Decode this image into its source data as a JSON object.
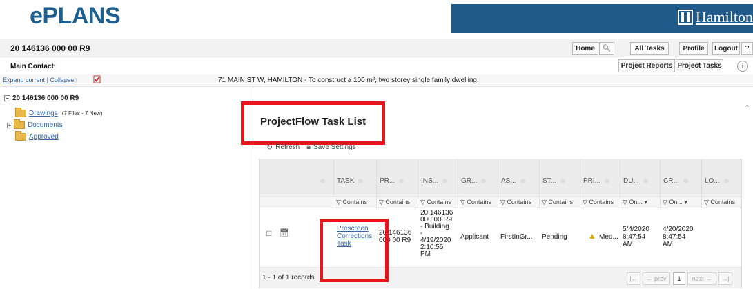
{
  "header": {
    "logo": "ePLANS",
    "city_logo": "Hamilton"
  },
  "titlebar": {
    "project_id": "20 146136 000 00 R9",
    "home": "Home",
    "all_tasks": "All Tasks",
    "profile": "Profile",
    "logout": "Logout",
    "help": "?",
    "project_reports": "Project Reports",
    "project_tasks": "Project Tasks",
    "info": "i"
  },
  "contact": {
    "label": "Main Contact:"
  },
  "expand": {
    "expand_current": "Expand current",
    "separator": "|",
    "collapse": "Collapse",
    "separator2": "|"
  },
  "address": "71 MAIN ST W, HAMILTON - To construct a 100 m², two storey single family dwelling.",
  "tree": {
    "root": "20 146136 000 00 R9",
    "items": [
      {
        "label": "Drawings",
        "note": "(7 Files - 7 New)"
      },
      {
        "label": "Documents",
        "note": ""
      },
      {
        "label": "Approved",
        "note": ""
      }
    ]
  },
  "panel": {
    "title": "ProjectFlow Task List",
    "refresh": "Refresh",
    "save_settings": "Save Settings"
  },
  "grid": {
    "columns": [
      "TASK",
      "PR...",
      "INS...",
      "GR...",
      "AS...",
      "ST...",
      "PRI...",
      "DU...",
      "CR...",
      "LO..."
    ],
    "filters": [
      "▽ Contains",
      "▽ Contains",
      "▽ Contains",
      "▽ Contains",
      "▽ Contains",
      "▽ Contains",
      "▽ Contains",
      "▽ On... ▾",
      "▽ On... ▾",
      "▽ Contains"
    ],
    "row": {
      "task": [
        "Prescreen",
        "Corrections",
        "Task"
      ],
      "project": [
        "20 146136",
        "000 00 R9"
      ],
      "instance": [
        "20 146136",
        "000 00 R9",
        "- Building",
        "-",
        "4/19/2020",
        "2:10:55",
        "PM"
      ],
      "group": "Applicant",
      "assigned": "FirstInGr...",
      "status": "Pending",
      "priority": "Med...",
      "due": [
        "5/4/2020",
        "8:47:54",
        "AM"
      ],
      "created": [
        "4/20/2020",
        "8:47:54",
        "AM"
      ]
    },
    "footer": {
      "records": "1 - 1 of 1 records",
      "first": "|←",
      "prev": "← prev",
      "page": "1",
      "next": "next →",
      "last": "→|"
    }
  },
  "colors": {
    "brand_blue": "#1f5f8d",
    "hamilton_bar": "#1f5a8a",
    "highlight_red": "#e8141b",
    "link": "#3567a8"
  }
}
